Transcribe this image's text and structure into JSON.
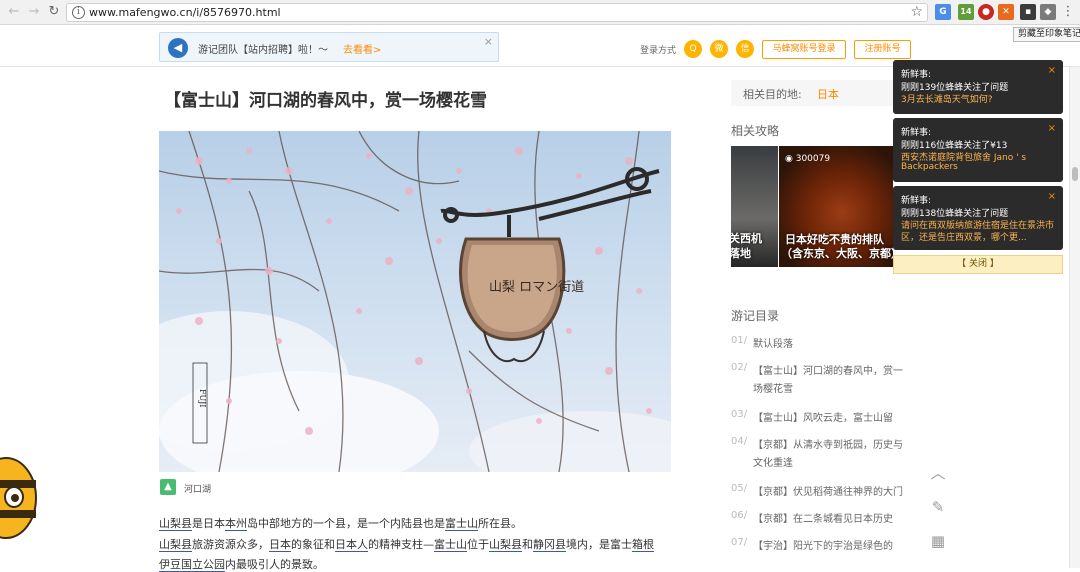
{
  "browser": {
    "back_icon": "←",
    "forward_icon": "→",
    "reload_icon": "↻",
    "info_icon": "i",
    "url": "www.mafengwo.cn/i/8576970.html",
    "star_icon": "☆",
    "ext_badge": "14",
    "menu_icon": "⋮",
    "tooltip": "剪藏至印象笔记"
  },
  "header": {
    "notice_text": "游记团队【站内招聘】啦！～",
    "notice_link": "去看看>",
    "notice_close": "×",
    "login_label": "登录方式",
    "social": [
      "Q",
      "微",
      "信"
    ],
    "mafengwo_login": "马蜂窝账号登录",
    "register": "注册账号"
  },
  "article": {
    "title": "【富士山】河口湖的春风中，赏一场樱花雪",
    "sign_text": "山梨 ロマン街道",
    "fuji_text": "FUJI",
    "image_caption": "河口湖",
    "paragraphs": [
      {
        "pre": "",
        "parts": [
          "山梨县",
          "是日本",
          "本州",
          "岛中部地方的一个县，是一个内陆县也是",
          "富士山",
          "所在县。"
        ]
      },
      {
        "pre": "",
        "parts": [
          "山梨县",
          "旅游资源众多，",
          "日本",
          "的象征和",
          "日本人",
          "的精神支柱—",
          "富士山",
          "位于",
          "山梨县",
          "和",
          "静冈县",
          "境内，是富士",
          "箱根"
        ]
      },
      {
        "pre": "",
        "parts": [
          "伊豆国立公园",
          "内最吸引人的景致。"
        ]
      }
    ]
  },
  "sidebar": {
    "dest_label": "相关目的地:",
    "dest_value": "日本",
    "guides_heading": "相关攻略",
    "guide1_line1": "关西机",
    "guide1_line2": "落地",
    "guide2_views": "300079",
    "guide2_line1": "日本好吃不贵的排队",
    "guide2_line2": "（含东京、大阪、京都）",
    "toc_heading": "游记目录",
    "toc": [
      {
        "num": "01/",
        "text": "默认段落",
        "text2": ""
      },
      {
        "num": "02/",
        "text": "【富士山】河口湖的春风中，赏一",
        "text2": "场樱花雪"
      },
      {
        "num": "03/",
        "text": "【富士山】风吹云走，富士山留",
        "text2": ""
      },
      {
        "num": "04/",
        "text": "【京都】从清水寺到祗园，历史与",
        "text2": "文化重逢"
      },
      {
        "num": "05/",
        "text": "【京都】伏见稻荷通往神界的大门",
        "text2": ""
      },
      {
        "num": "06/",
        "text": "【京都】在二条城看见日本历史",
        "text2": ""
      },
      {
        "num": "07/",
        "text": "【宇治】阳光下的宇治是绿色的",
        "text2": ""
      }
    ]
  },
  "tools": {
    "top_icon": "︿",
    "edit_icon": "✎",
    "qr_icon": "▦"
  },
  "popups": [
    {
      "title": "新鲜事:",
      "l1": "刚刚139位蜂蜂关注了问题",
      "l2": "3月去长滩岛天气如何?",
      "l3": "",
      "close": "×"
    },
    {
      "title": "新鲜事:",
      "l1": "刚刚116位蜂蜂关注了¥13",
      "l2": "西安杰诺庭院背包旅舍 Jano ' s",
      "l3": "Backpackers",
      "close": "×"
    },
    {
      "title": "新鲜事:",
      "l1": "刚刚138位蜂蜂关注了问题",
      "l2": "请问在西双版纳旅游住宿是住在景洪市",
      "l3": "区，还是告庄西双景，哪个更...",
      "close": "×"
    }
  ],
  "close_all": "【 关闭 】"
}
